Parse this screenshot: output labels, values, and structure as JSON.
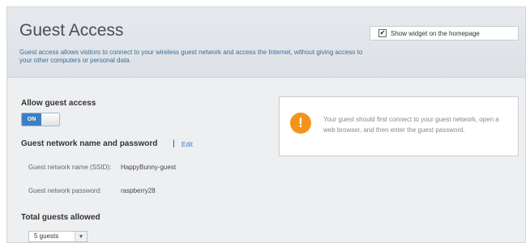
{
  "header": {
    "title": "Guest Access",
    "description": "Guest access allows visitors to connect to your wireless guest network and access the Internet, without giving access to your other computers or personal data.",
    "widget_checkbox_label": "Show widget on the homepage",
    "widget_checked": true,
    "refresh_icon": "↻"
  },
  "allow": {
    "label": "Allow guest access",
    "toggle_state": "ON"
  },
  "network": {
    "heading": "Guest network name and password",
    "separator": "|",
    "edit_label": "Edit",
    "ssid_label": "Guest network name (SSID):",
    "ssid_value": "HappyBunny-guest",
    "password_label": "Guest network password:",
    "password_value": "raspberry28"
  },
  "guests": {
    "label": "Total guests allowed",
    "selected": "5 guests"
  },
  "info": {
    "icon": "!",
    "message": "Your guest should first connect to your guest network, open a web browser, and then enter the guest password."
  },
  "colors": {
    "accent": "#3d7fc1",
    "link": "#3b78c6",
    "warning": "#f2941c"
  }
}
